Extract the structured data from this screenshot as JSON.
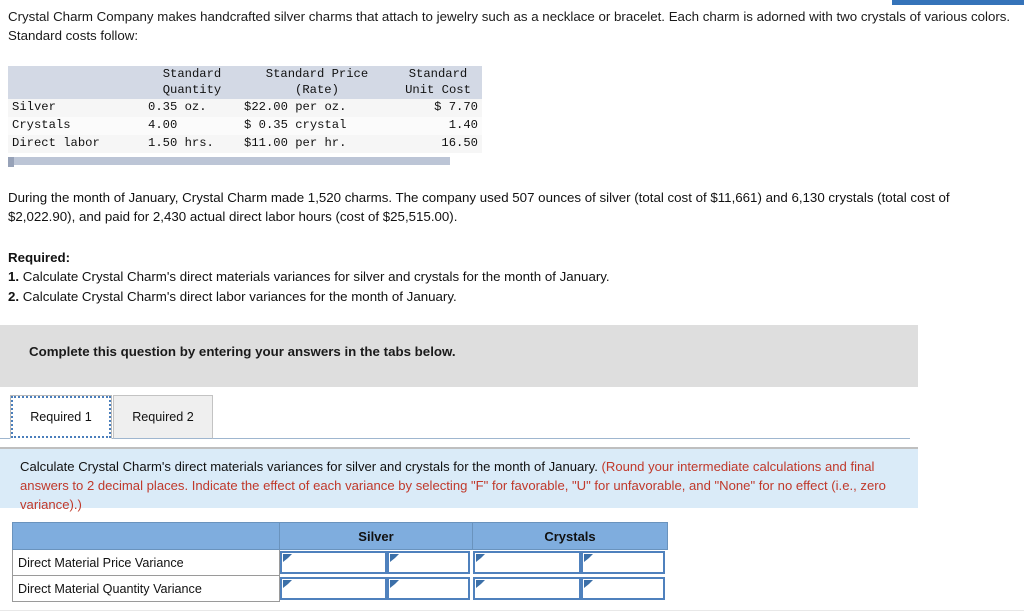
{
  "accent": {
    "top_bar_color": "#3573b9",
    "header_blue": "#7fadde",
    "instruction_blue": "#daebf8",
    "banner_gray": "#dedede",
    "red_text": "#c0392b",
    "input_border": "#4f81bd"
  },
  "intro": {
    "paragraph": "Crystal Charm Company makes handcrafted silver charms that attach to jewelry such as a necklace or bracelet. Each charm is adorned with two crystals of various colors. Standard costs follow:"
  },
  "standard_cost_table": {
    "headers": [
      "",
      "Standard Quantity",
      "Standard Price (Rate)",
      "Standard Unit Cost"
    ],
    "header_lines": {
      "col1_line1": "Standard",
      "col1_line2": "Quantity",
      "col2_line1": "Standard Price",
      "col2_line2": "(Rate)",
      "col3_line1": "Standard",
      "col3_line2": "Unit Cost"
    },
    "rows": [
      {
        "label": "Silver",
        "standard_quantity": "0.35 oz.",
        "standard_price": "$22.00 per oz.",
        "standard_unit_cost": "$ 7.70"
      },
      {
        "label": "Crystals",
        "standard_quantity": "4.00",
        "standard_price": "$ 0.35 crystal",
        "standard_unit_cost": "1.40"
      },
      {
        "label": "Direct labor",
        "standard_quantity": "1.50 hrs.",
        "standard_price": "$11.00 per hr.",
        "standard_unit_cost": "16.50"
      }
    ]
  },
  "during_month": {
    "paragraph": "During the month of January, Crystal Charm made 1,520 charms. The company used 507 ounces of silver (total cost of $11,661) and 6,130 crystals (total cost of $2,022.90), and paid for 2,430 actual direct labor hours (cost of $25,515.00)."
  },
  "required": {
    "heading": "Required:",
    "items": [
      {
        "num": "1.",
        "text": "Calculate Crystal Charm's direct materials variances for silver and crystals for the month of January."
      },
      {
        "num": "2.",
        "text": "Calculate Crystal Charm's direct labor variances for the month of January."
      }
    ]
  },
  "banner": {
    "text": "Complete this question by entering your answers in the tabs below."
  },
  "tabs": [
    {
      "label": "Required 1",
      "active": true
    },
    {
      "label": "Required 2",
      "active": false
    }
  ],
  "instruction_box": {
    "main": "Calculate Crystal Charm's direct materials variances for silver and crystals for the month of January.",
    "note": "(Round your intermediate calculations and final answers to 2 decimal places. Indicate the effect of each variance by selecting \"F\" for favorable, \"U\" for unfavorable, and \"None\" for no effect (i.e., zero variance).)"
  },
  "answer_table": {
    "column_headers": [
      "",
      "Silver",
      "Crystals"
    ],
    "rows": [
      {
        "label": "Direct Material Price Variance",
        "silver_value": "",
        "silver_effect": "",
        "crystals_value": "",
        "crystals_effect": ""
      },
      {
        "label": "Direct Material Quantity Variance",
        "silver_value": "",
        "silver_effect": "",
        "crystals_value": "",
        "crystals_effect": ""
      }
    ]
  }
}
